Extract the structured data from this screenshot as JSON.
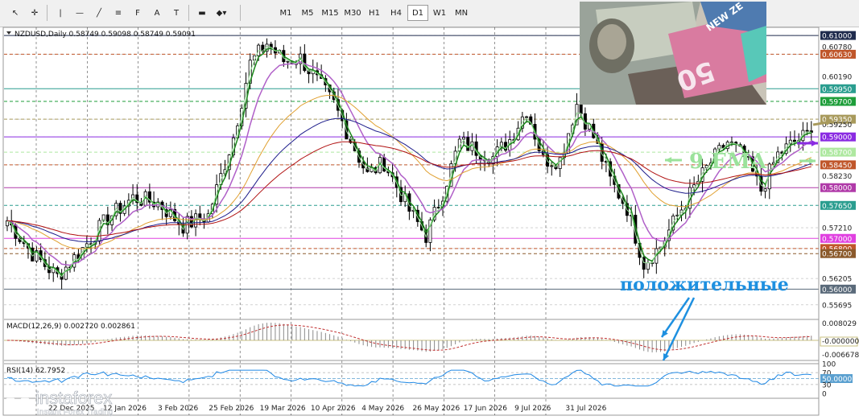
{
  "toolbar": {
    "tools": [
      {
        "name": "cursor-icon",
        "glyph": "↖"
      },
      {
        "name": "crosshair-icon",
        "glyph": "✛"
      },
      {
        "name": "vertical-line-icon",
        "glyph": "|"
      },
      {
        "name": "horizontal-line-icon",
        "glyph": "—"
      },
      {
        "name": "trendline-icon",
        "glyph": "╱"
      },
      {
        "name": "channel-icon",
        "glyph": "≡"
      },
      {
        "name": "fibonacci-icon",
        "glyph": "F"
      },
      {
        "name": "text-icon",
        "glyph": "A"
      },
      {
        "name": "label-icon",
        "glyph": "T"
      },
      {
        "name": "rectangle-icon",
        "glyph": "▬"
      },
      {
        "name": "shapes-icon",
        "glyph": "◆▾"
      }
    ],
    "timeframes": [
      "M1",
      "M5",
      "M15",
      "M30",
      "H1",
      "H4",
      "D1",
      "W1",
      "MN"
    ],
    "active_timeframe": "D1"
  },
  "chart_data": {
    "type": "candlestick",
    "symbol_info": "NZDUSD,Daily  0.58749 0.59098 0.58749 0.59091",
    "ylim": [
      0.5545,
      0.6116
    ],
    "price_labels": [
      {
        "value": 0.61,
        "text": "0.61000",
        "color": "#1f2b4d"
      },
      {
        "value": 0.6078,
        "text": "0.60780",
        "color": null
      },
      {
        "value": 0.6063,
        "text": "0.60630",
        "color": "#c0562a"
      },
      {
        "value": 0.6019,
        "text": "0.60190",
        "color": null
      },
      {
        "value": 0.5995,
        "text": "0.59950",
        "color": "#2a9d8f"
      },
      {
        "value": 0.597,
        "text": "0.59700",
        "color": "#1e9e3a"
      },
      {
        "value": 0.5935,
        "text": "0.59350",
        "color": "#a89a5c"
      },
      {
        "value": 0.5925,
        "text": "0.59250",
        "color": null
      },
      {
        "value": 0.59,
        "text": "0.59000",
        "color": "#8a2be2"
      },
      {
        "value": 0.587,
        "text": "0.58700",
        "color": "#aee8a0"
      },
      {
        "value": 0.5845,
        "text": "0.58450",
        "color": "#c0562a"
      },
      {
        "value": 0.5823,
        "text": "0.58230",
        "color": null
      },
      {
        "value": 0.58,
        "text": "0.58000",
        "color": "#b03aa8"
      },
      {
        "value": 0.5765,
        "text": "0.57650",
        "color": "#2a9d8f"
      },
      {
        "value": 0.5721,
        "text": "0.57210",
        "color": null
      },
      {
        "value": 0.57,
        "text": "0.57000",
        "color": "#e040e0"
      },
      {
        "value": 0.568,
        "text": "0.56800",
        "color": "#c0562a"
      },
      {
        "value": 0.567,
        "text": "0.56700",
        "color": "#8b5a2b"
      },
      {
        "value": 0.5621,
        "text": "0.56205",
        "color": null
      },
      {
        "value": 0.56,
        "text": "0.56000",
        "color": "#5a6a7a"
      },
      {
        "value": 0.5569,
        "text": "0.55695",
        "color": null
      }
    ],
    "horizontal_levels": [
      {
        "value": 0.61,
        "color": "#1f2b4d",
        "style": "solid"
      },
      {
        "value": 0.6063,
        "color": "#c0562a",
        "style": "dashed"
      },
      {
        "value": 0.5995,
        "color": "#2a9d8f",
        "style": "solid"
      },
      {
        "value": 0.597,
        "color": "#1e9e3a",
        "style": "dashed"
      },
      {
        "value": 0.5935,
        "color": "#a89a5c",
        "style": "dashed"
      },
      {
        "value": 0.59,
        "color": "#8a2be2",
        "style": "solid"
      },
      {
        "value": 0.587,
        "color": "#aee8a0",
        "style": "dashed"
      },
      {
        "value": 0.5845,
        "color": "#c0562a",
        "style": "dashed"
      },
      {
        "value": 0.58,
        "color": "#b03aa8",
        "style": "solid"
      },
      {
        "value": 0.5765,
        "color": "#2a9d8f",
        "style": "dashed"
      },
      {
        "value": 0.57,
        "color": "#e040e0",
        "style": "solid"
      },
      {
        "value": 0.568,
        "color": "#c0562a",
        "style": "dashed"
      },
      {
        "value": 0.567,
        "color": "#8b5a2b",
        "style": "dashed"
      },
      {
        "value": 0.56,
        "color": "#5a6a7a",
        "style": "solid"
      }
    ],
    "date_labels": [
      "22 Dec 2025",
      "12 Jan 2026",
      "3 Feb 2026",
      "25 Feb 2026",
      "19 Mar 2026",
      "10 Apr 2026",
      "4 May 2026",
      "26 May 2026",
      "17 Jun 2026",
      "9 Jul 2026",
      "31 Jul 2026"
    ],
    "price_path": [
      [
        0,
        0.5735
      ],
      [
        6,
        0.567
      ],
      [
        12,
        0.5625
      ],
      [
        18,
        0.568
      ],
      [
        24,
        0.574
      ],
      [
        30,
        0.578
      ],
      [
        36,
        0.577
      ],
      [
        42,
        0.5725
      ],
      [
        48,
        0.5745
      ],
      [
        54,
        0.59
      ],
      [
        58,
        0.6045
      ],
      [
        62,
        0.6085
      ],
      [
        66,
        0.605
      ],
      [
        70,
        0.6055
      ],
      [
        74,
        0.601
      ],
      [
        78,
        0.5965
      ],
      [
        82,
        0.5895
      ],
      [
        86,
        0.5825
      ],
      [
        90,
        0.585
      ],
      [
        96,
        0.5755
      ],
      [
        100,
        0.5705
      ],
      [
        104,
        0.579
      ],
      [
        108,
        0.589
      ],
      [
        112,
        0.5875
      ],
      [
        116,
        0.586
      ],
      [
        120,
        0.5895
      ],
      [
        124,
        0.5955
      ],
      [
        128,
        0.5855
      ],
      [
        132,
        0.5855
      ],
      [
        136,
        0.5965
      ],
      [
        140,
        0.59
      ],
      [
        144,
        0.5815
      ],
      [
        148,
        0.576
      ],
      [
        152,
        0.565
      ],
      [
        156,
        0.5685
      ],
      [
        160,
        0.5745
      ],
      [
        164,
        0.58
      ],
      [
        168,
        0.585
      ],
      [
        172,
        0.589
      ],
      [
        176,
        0.586
      ],
      [
        180,
        0.5795
      ],
      [
        184,
        0.5865
      ],
      [
        188,
        0.589
      ],
      [
        192,
        0.5909
      ]
    ],
    "indicators": [
      {
        "name": "9 EMA",
        "period": 3,
        "color": "#1a8a1a",
        "width": 1.5
      },
      {
        "name": "",
        "period": 9,
        "color": "#b060c8",
        "width": 1.5
      },
      {
        "name": "",
        "period": 2,
        "color": "#9be29b",
        "width": 1
      },
      {
        "name": "",
        "period": 28,
        "color": "#e0a030",
        "width": 1
      },
      {
        "name": "",
        "period": 45,
        "color": "#1c1c8a",
        "width": 1
      },
      {
        "name": "",
        "period": 70,
        "color": "#b01010",
        "width": 1
      }
    ],
    "macd": {
      "label": "MACD(12,26,9) 0.002720 0.002861",
      "scale_labels": [
        "0.008029",
        "-0.000000",
        "-0.006678"
      ]
    },
    "rsi": {
      "label": "RSI(14) 62.7952",
      "scale_labels": [
        "100",
        "70",
        "50.0000",
        "30",
        "0"
      ],
      "value": 62.7952
    },
    "annotations": {
      "ema_label": "9 EMA",
      "positive_label": "положительные"
    }
  },
  "logo": {
    "brand": "instaforex",
    "tagline": "Instant Forex Trading"
  },
  "photo": {
    "note_value": "50",
    "note_text": "NEW ZE"
  }
}
